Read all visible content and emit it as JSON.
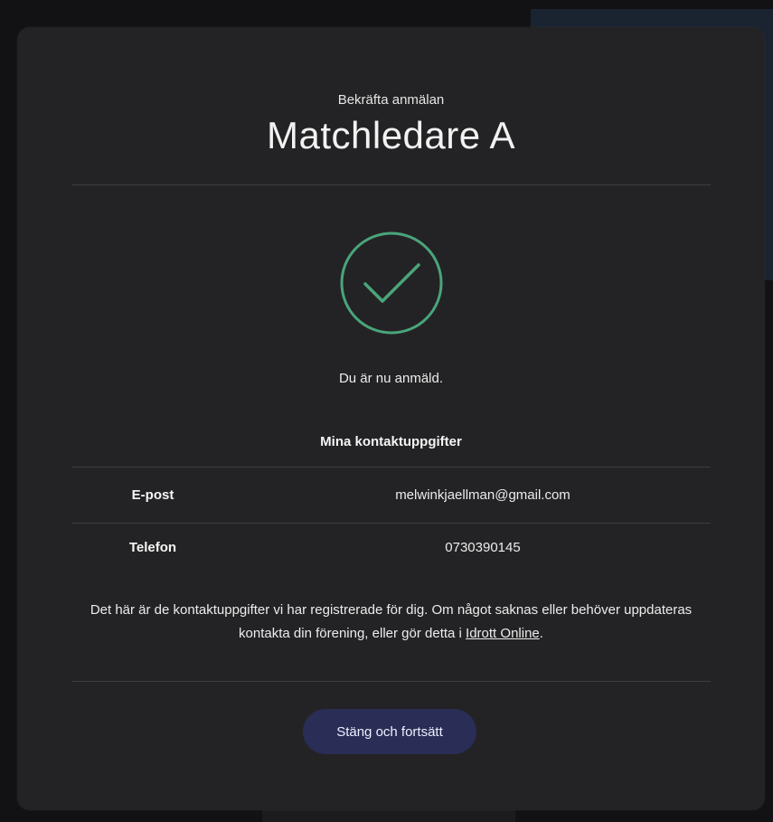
{
  "modal": {
    "subtitle": "Bekräfta anmälan",
    "title": "Matchledare A",
    "success_message": "Du är nu anmäld.",
    "contact_heading": "Mina kontaktuppgifter",
    "contacts": [
      {
        "label": "E-post",
        "value": "melwinkjaellman@gmail.com"
      },
      {
        "label": "Telefon",
        "value": "0730390145"
      }
    ],
    "info_text": "Det här är de kontaktuppgifter vi har registrerade för dig. Om något saknas eller behöver uppdateras kontakta din förening, eller gör detta i ",
    "info_link": "Idrott Online",
    "info_end": ".",
    "close_button": "Stäng och fortsätt",
    "success_icon": "check-circle-icon",
    "accent_color": "#4aa57a"
  }
}
